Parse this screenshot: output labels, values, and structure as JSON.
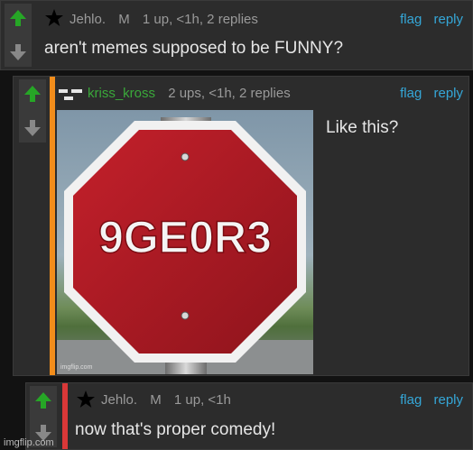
{
  "comments": [
    {
      "username": "Jehlo.",
      "badge": "M",
      "stats": "1 up, <1h, 2 replies",
      "flag": "flag",
      "reply": "reply",
      "text": "aren't memes supposed to be FUNNY?"
    },
    {
      "username": "kriss_kross",
      "stats": "2 ups, <1h, 2 replies",
      "flag": "flag",
      "reply": "reply",
      "text": "Like this?",
      "image_sign_text": "9GE0R3",
      "image_watermark": "imgflip.com"
    },
    {
      "username": "Jehlo.",
      "badge": "M",
      "stats": "1 up, <1h",
      "flag": "flag",
      "reply": "reply",
      "text": "now that's proper comedy!"
    }
  ],
  "site_watermark": "imgflip.com",
  "colors": {
    "upvote": "#26a626",
    "downvote": "#888888",
    "link": "#35a7d8",
    "username_green": "#3aa83a",
    "accent_orange": "#f28d1b",
    "accent_red": "#d93838"
  },
  "icons": [
    "upvote-arrow-icon",
    "downvote-arrow-icon",
    "star-icon",
    "user-flag-icon"
  ]
}
